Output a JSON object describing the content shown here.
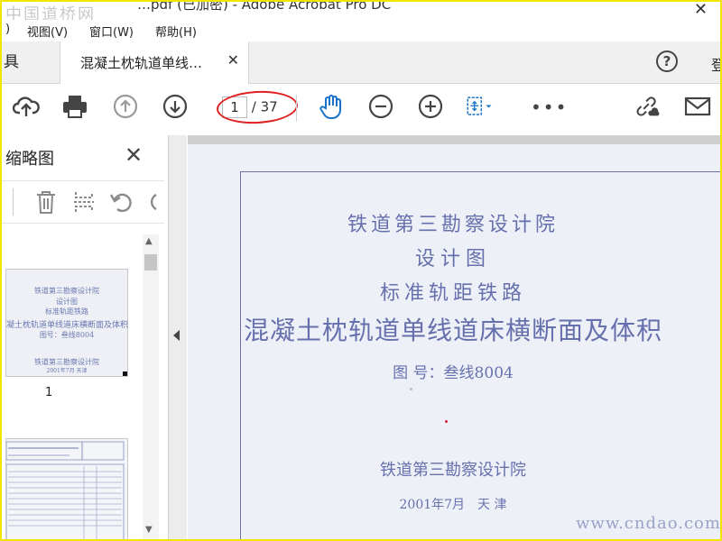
{
  "window": {
    "title_fragment": "…pdf (已加密) - Adobe Acrobat Pro DC",
    "watermark": "中国道桥网",
    "close_glyph": "✕"
  },
  "menu": {
    "items": [
      "视图(V)",
      "窗口(W)",
      "帮助(H)"
    ],
    "first_fragment": ")"
  },
  "tabs": {
    "home_label": "具",
    "doc_label": "混凝土枕轨道单线…",
    "doc_close": "✕",
    "help_glyph": "?",
    "signin_fragment": "登"
  },
  "toolbar": {
    "page_current": "1",
    "page_total": "/ 37",
    "more_glyph": "•••"
  },
  "thumbnail_panel": {
    "title": "缩略图",
    "close_glyph": "✕",
    "page1_label": "1",
    "thumb1_lines": [
      "铁道第三勘察设计院",
      "设计图",
      "标准轨距铁路",
      "凝土枕轨道单线道床横断面及体积",
      "图号：叁线8004",
      "铁道第三勘察设计院",
      "2001年7月  天津"
    ]
  },
  "document": {
    "line1": "铁道第三勘察设计院",
    "line2": "设计图",
    "line3": "标准轨距铁路",
    "line4": "混凝土枕轨道单线道床横断面及体积",
    "line5": "图 号：叁线8004",
    "line6": "铁道第三勘察设计院",
    "line7": "2001年7月　天 津",
    "watermark": "www.cndao.com"
  },
  "colors": {
    "highlight_border": "#f2e600",
    "annotation_red": "#e02020",
    "doc_text": "#6670ad",
    "accent_blue": "#1a73c8"
  }
}
